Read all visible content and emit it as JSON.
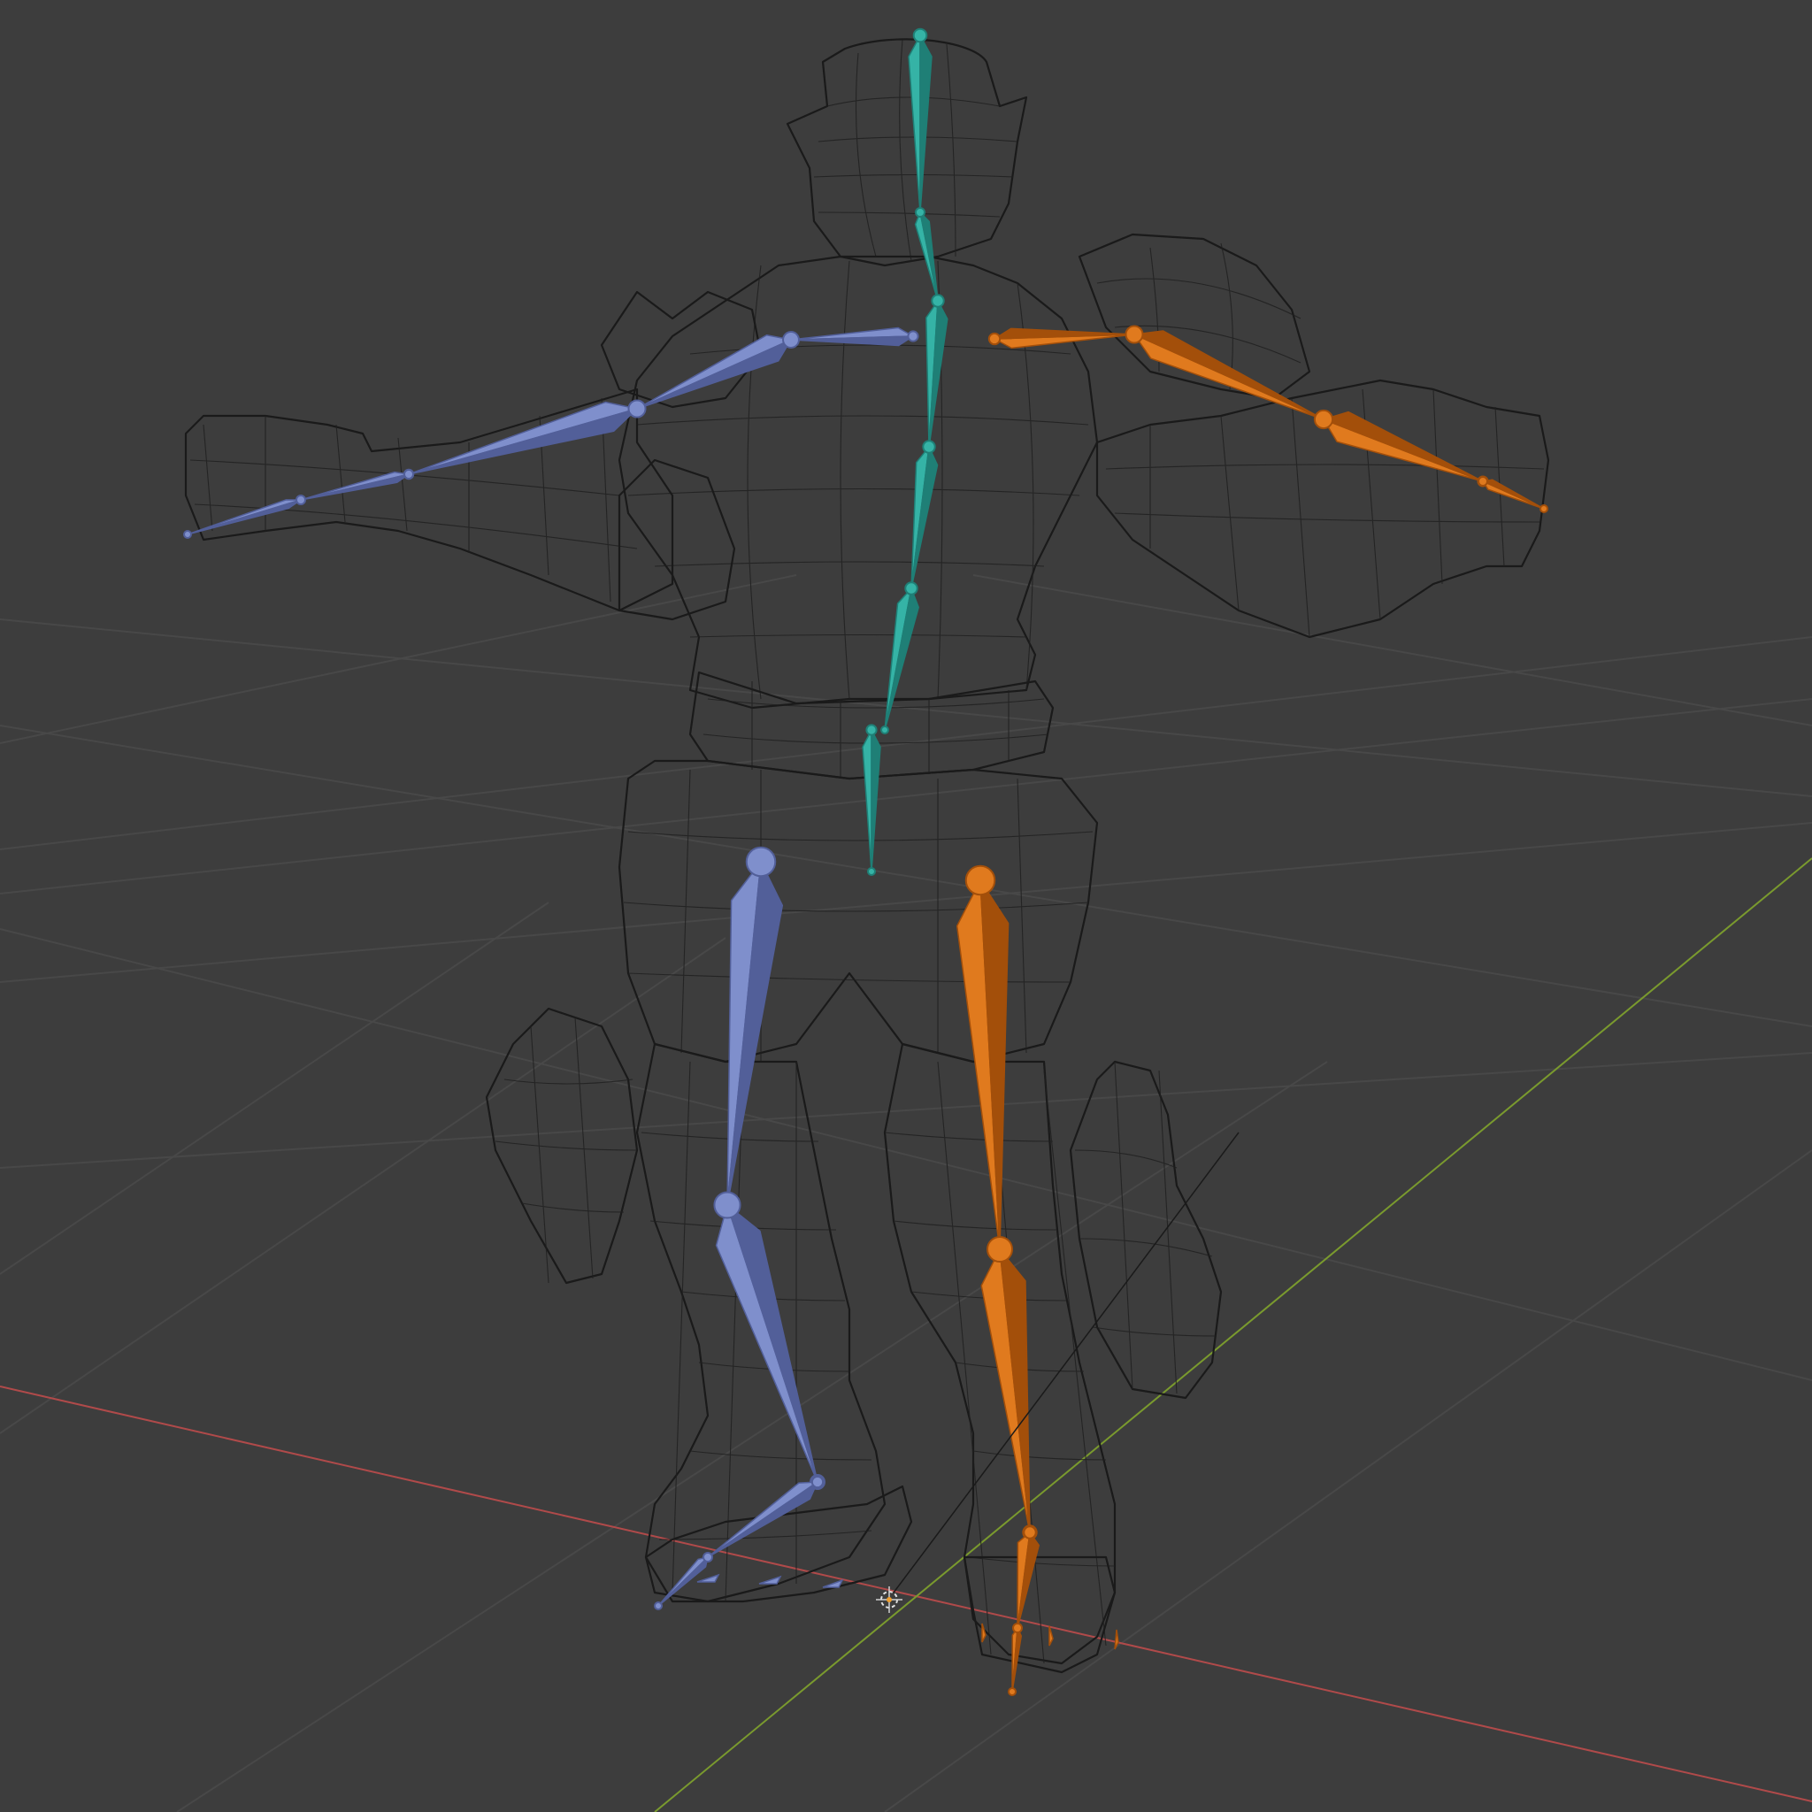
{
  "viewport": {
    "background": "#3d3d3d",
    "grid_color": "#484848",
    "wireframe_color": "#1a1a1a"
  },
  "axes": {
    "x_axis_color": "#b04a4a",
    "y_axis_color": "#7a9a2e"
  },
  "armature": {
    "display": "octahedral",
    "groups": [
      {
        "id": "spine",
        "color": "#35b3a6",
        "shade": "#1f7f76"
      },
      {
        "id": "left-side",
        "color": "#7f8fcc",
        "shade": "#525f99"
      },
      {
        "id": "right-side",
        "color": "#e07a1e",
        "shade": "#a34f0a"
      }
    ]
  },
  "object_origin_icon": "3d-cursor-icon",
  "icons": [
    "3d-cursor-icon",
    "origin-dot-icon"
  ]
}
